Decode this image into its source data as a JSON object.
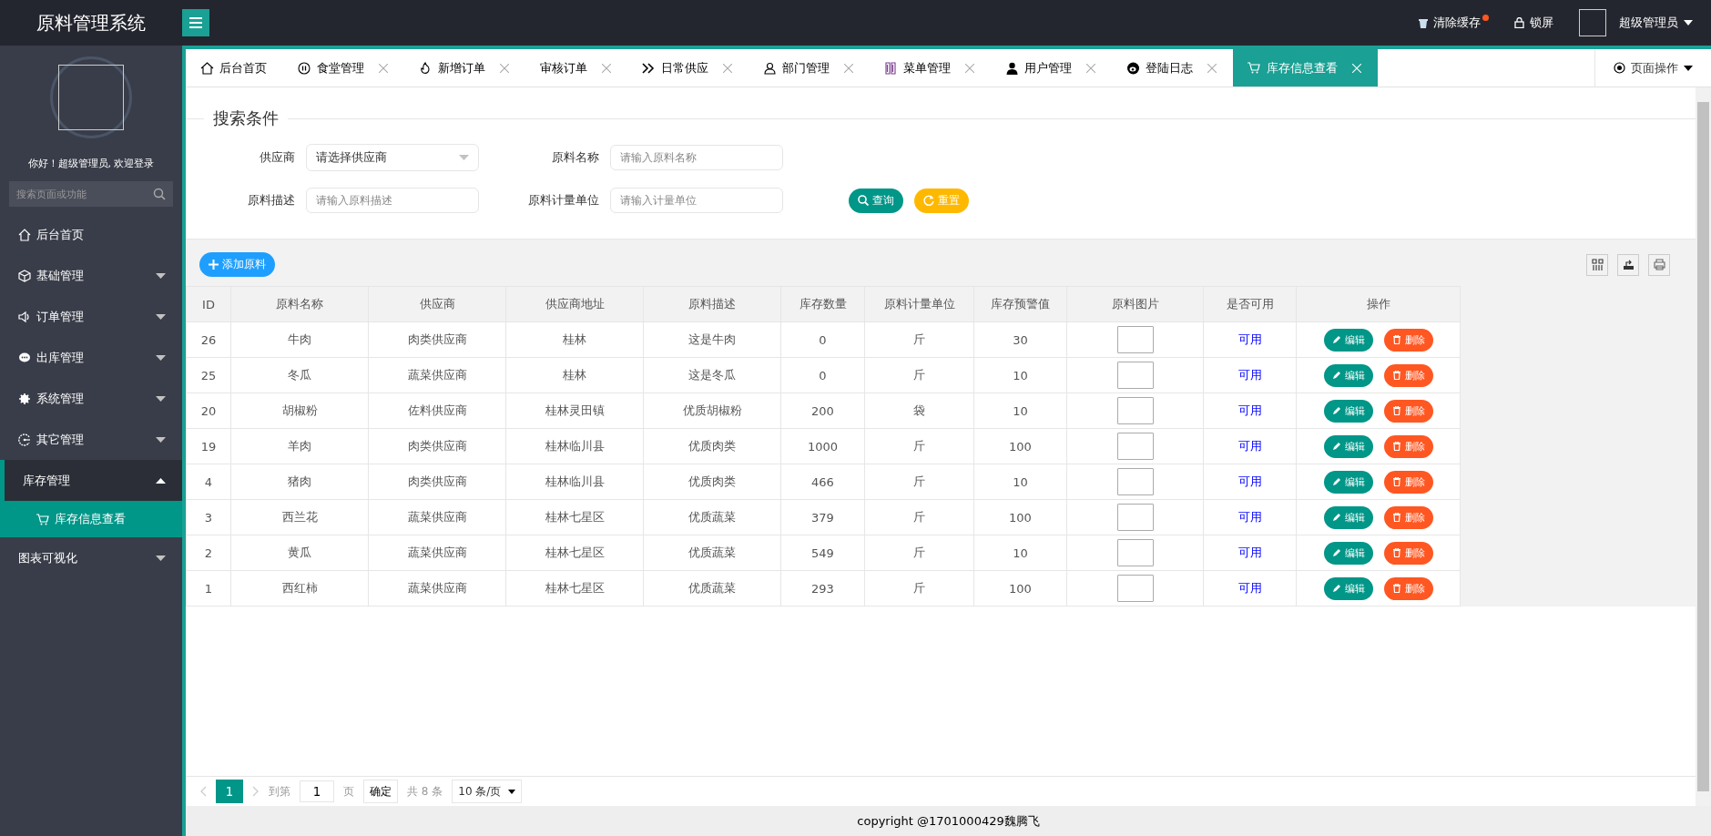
{
  "header": {
    "title": "原料管理系统",
    "clear_cache": "清除缓存",
    "lock": "锁屏",
    "user": "超级管理员"
  },
  "sidebar": {
    "greeting": "你好！超级管理员, 欢迎登录",
    "search_placeholder": "搜索页面或功能",
    "items": [
      {
        "label": "后台首页",
        "kind": "link",
        "selected": false
      },
      {
        "label": "基础管理",
        "kind": "group",
        "expanded": false,
        "selected": false
      },
      {
        "label": "订单管理",
        "kind": "group",
        "expanded": false,
        "selected": false
      },
      {
        "label": "出库管理",
        "kind": "group",
        "expanded": false,
        "selected": false
      },
      {
        "label": "系统管理",
        "kind": "group",
        "expanded": false,
        "selected": false
      },
      {
        "label": "其它管理",
        "kind": "group",
        "expanded": false,
        "selected": false
      },
      {
        "label": "库存管理",
        "kind": "group",
        "expanded": true,
        "selected": false,
        "children": [
          {
            "label": "库存信息查看",
            "selected": true
          }
        ]
      },
      {
        "label": "图表可视化",
        "kind": "group",
        "expanded": false,
        "selected": false
      }
    ]
  },
  "tabs": [
    {
      "label": "后台首页",
      "closable": false,
      "selected": false
    },
    {
      "label": "食堂管理",
      "closable": true,
      "selected": false
    },
    {
      "label": "新增订单",
      "closable": true,
      "selected": false
    },
    {
      "label": "审核订单",
      "closable": true,
      "selected": false
    },
    {
      "label": "日常供应",
      "closable": true,
      "selected": false
    },
    {
      "label": "部门管理",
      "closable": true,
      "selected": false
    },
    {
      "label": "菜单管理",
      "closable": true,
      "selected": false
    },
    {
      "label": "用户管理",
      "closable": true,
      "selected": false
    },
    {
      "label": "登陆日志",
      "closable": true,
      "selected": false
    },
    {
      "label": "库存信息查看",
      "closable": true,
      "selected": true
    }
  ],
  "page_ops": "页面操作",
  "search": {
    "legend": "搜索条件",
    "fields": [
      {
        "label": "供应商",
        "kind": "select",
        "value": "请选择供应商"
      },
      {
        "label": "原料名称",
        "kind": "input",
        "placeholder": "请输入原料名称"
      },
      {
        "label": "原料描述",
        "kind": "input",
        "placeholder": "请输入原料描述"
      },
      {
        "label": "原料计量单位",
        "kind": "input",
        "placeholder": "请输入计量单位"
      }
    ],
    "query": "查询",
    "reset": "重置"
  },
  "add_button": "添加原料",
  "table": {
    "columns": [
      "ID",
      "原料名称",
      "供应商",
      "供应商地址",
      "原料描述",
      "库存数量",
      "原料计量单位",
      "库存预警值",
      "原料图片",
      "是否可用",
      "操作"
    ],
    "rows": [
      {
        "cells": [
          "26",
          "牛肉",
          "肉类供应商",
          "桂林",
          "这是牛肉",
          "0",
          "斤",
          "30"
        ],
        "available": "可用",
        "edit": "编辑",
        "delete": "删除"
      },
      {
        "cells": [
          "25",
          "冬瓜",
          "蔬菜供应商",
          "桂林",
          "这是冬瓜",
          "0",
          "斤",
          "10"
        ],
        "available": "可用",
        "edit": "编辑",
        "delete": "删除"
      },
      {
        "cells": [
          "20",
          "胡椒粉",
          "佐料供应商",
          "桂林灵田镇",
          "优质胡椒粉",
          "200",
          "袋",
          "10"
        ],
        "available": "可用",
        "edit": "编辑",
        "delete": "删除"
      },
      {
        "cells": [
          "19",
          "羊肉",
          "肉类供应商",
          "桂林临川县",
          "优质肉类",
          "1000",
          "斤",
          "100"
        ],
        "available": "可用",
        "edit": "编辑",
        "delete": "删除"
      },
      {
        "cells": [
          "4",
          "猪肉",
          "肉类供应商",
          "桂林临川县",
          "优质肉类",
          "466",
          "斤",
          "10"
        ],
        "available": "可用",
        "edit": "编辑",
        "delete": "删除"
      },
      {
        "cells": [
          "3",
          "西兰花",
          "蔬菜供应商",
          "桂林七星区",
          "优质蔬菜",
          "379",
          "斤",
          "100"
        ],
        "available": "可用",
        "edit": "编辑",
        "delete": "删除"
      },
      {
        "cells": [
          "2",
          "黄瓜",
          "蔬菜供应商",
          "桂林七星区",
          "优质蔬菜",
          "549",
          "斤",
          "10"
        ],
        "available": "可用",
        "edit": "编辑",
        "delete": "删除"
      },
      {
        "cells": [
          "1",
          "西红柿",
          "蔬菜供应商",
          "桂林七星区",
          "优质蔬菜",
          "293",
          "斤",
          "100"
        ],
        "available": "可用",
        "edit": "编辑",
        "delete": "删除"
      }
    ]
  },
  "pagination": {
    "pages": [
      {
        "label": "1",
        "selected": true
      }
    ],
    "goto_label": "到第",
    "page_input": "1",
    "page_suffix": "页",
    "confirm": "确定",
    "total": "共 8 条",
    "page_size": "10 条/页"
  },
  "footer": "copyright @1701000429魏腾飞"
}
